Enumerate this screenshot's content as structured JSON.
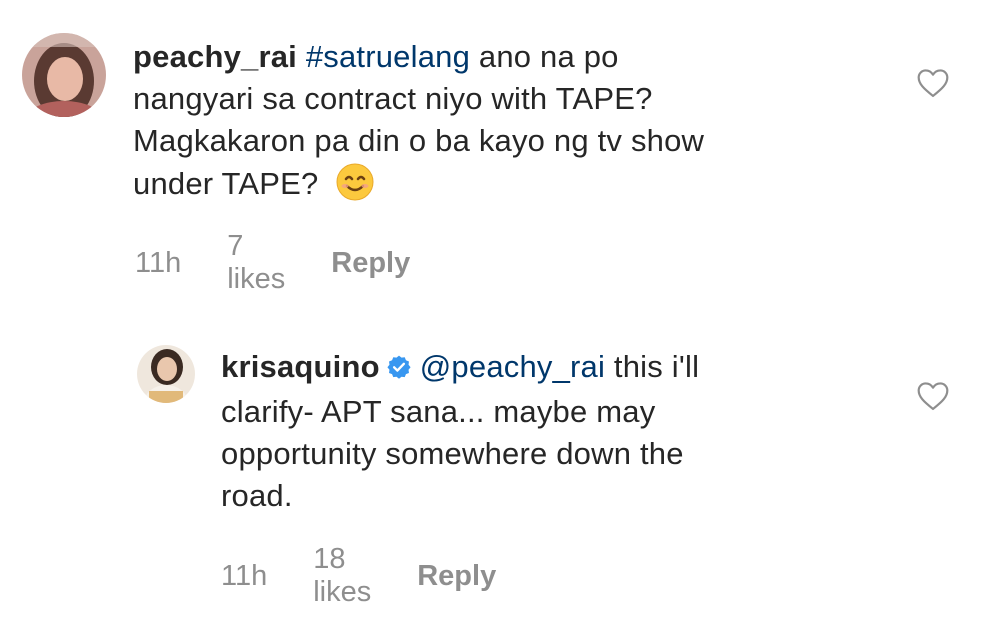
{
  "comments": [
    {
      "username": "peachy_rai",
      "hashtag": "#satruelang",
      "text_line1": "ano na po",
      "text_line2": "nangyari sa contract niyo with TAPE?",
      "text_line3": "Magkakaron pa din o ba kayo ng tv show",
      "text_line4": "under TAPE?",
      "emoji": "smiling-face-emoji",
      "time": "11h",
      "likes": "7 likes",
      "reply_label": "Reply",
      "verified": false
    },
    {
      "username": "krisaquino",
      "mention": "@peachy_rai",
      "text_line1": "this i'll",
      "text_line2": "clarify- APT sana... maybe may",
      "text_line3": "opportunity somewhere down the",
      "text_line4": "road.",
      "time": "11h",
      "likes": "18 likes",
      "reply_label": "Reply",
      "verified": true
    }
  ],
  "colors": {
    "text": "#262626",
    "link": "#00376b",
    "meta": "#8e8e8e",
    "verified_badge": "#3897f0"
  },
  "icons": {
    "like": "heart-outline-icon",
    "verified": "verified-badge-icon"
  }
}
